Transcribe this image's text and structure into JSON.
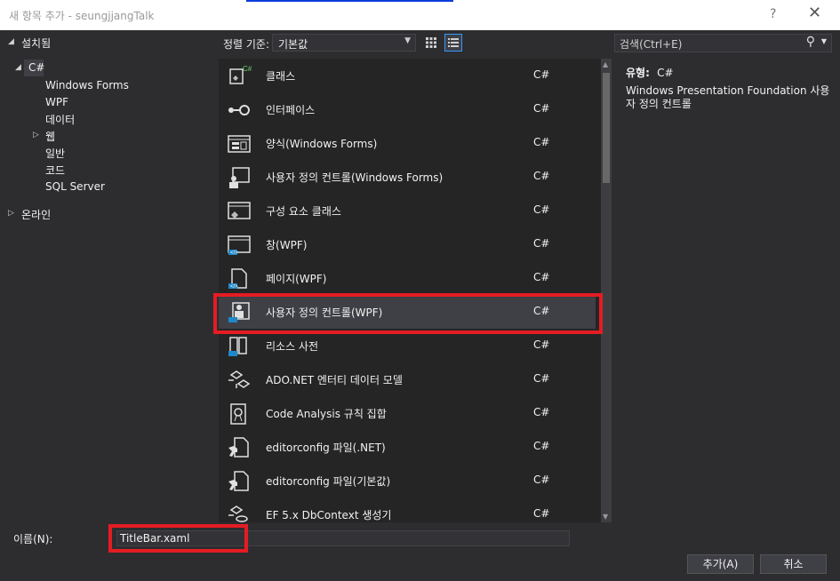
{
  "window": {
    "title": "새 항목 추가 - seungjjangTalk",
    "help": "?",
    "close": "✕"
  },
  "tree": {
    "installed": "설치됨",
    "csharp": "C#",
    "children": [
      "Windows Forms",
      "WPF",
      "데이터",
      "웹",
      "일반",
      "코드",
      "SQL Server"
    ],
    "online": "온라인"
  },
  "toolbar": {
    "sort_label": "정렬 기준:",
    "sort_value": "기본값",
    "search_placeholder": "검색(Ctrl+E)"
  },
  "templates": [
    {
      "name": "클래스",
      "lang": "C#",
      "icon": "class-icon"
    },
    {
      "name": "인터페이스",
      "lang": "C#",
      "icon": "interface-icon"
    },
    {
      "name": "양식(Windows Forms)",
      "lang": "C#",
      "icon": "form-icon"
    },
    {
      "name": "사용자 정의 컨트롤(Windows Forms)",
      "lang": "C#",
      "icon": "user-control-icon"
    },
    {
      "name": "구성 요소 클래스",
      "lang": "C#",
      "icon": "component-class-icon"
    },
    {
      "name": "창(WPF)",
      "lang": "C#",
      "icon": "window-icon"
    },
    {
      "name": "페이지(WPF)",
      "lang": "C#",
      "icon": "page-icon"
    },
    {
      "name": "사용자 정의 컨트롤(WPF)",
      "lang": "C#",
      "icon": "user-control-wpf-icon"
    },
    {
      "name": "리소스 사전",
      "lang": "C#",
      "icon": "resource-dictionary-icon"
    },
    {
      "name": "ADO.NET 엔터티 데이터 모델",
      "lang": "C#",
      "icon": "entity-model-icon"
    },
    {
      "name": "Code Analysis 규칙 집합",
      "lang": "C#",
      "icon": "rule-set-icon"
    },
    {
      "name": "editorconfig 파일(.NET)",
      "lang": "C#",
      "icon": "editorconfig-icon"
    },
    {
      "name": "editorconfig 파일(기본값)",
      "lang": "C#",
      "icon": "editorconfig-icon"
    },
    {
      "name": "EF 5.x DbContext 생성기",
      "lang": "C#",
      "icon": "dbcontext-icon"
    }
  ],
  "selected_index": 7,
  "details": {
    "type_label": "유형:",
    "type_value": "C#",
    "description": "Windows Presentation Foundation 사용자 정의 컨트롤"
  },
  "footer": {
    "name_label": "이름(N):",
    "name_value": "TitleBar.xaml",
    "add_button": "추가(A)",
    "cancel_button": "취소"
  },
  "colors": {
    "accent": "#3399ff",
    "highlight": "#e51c23",
    "background": "#2d2d30"
  }
}
